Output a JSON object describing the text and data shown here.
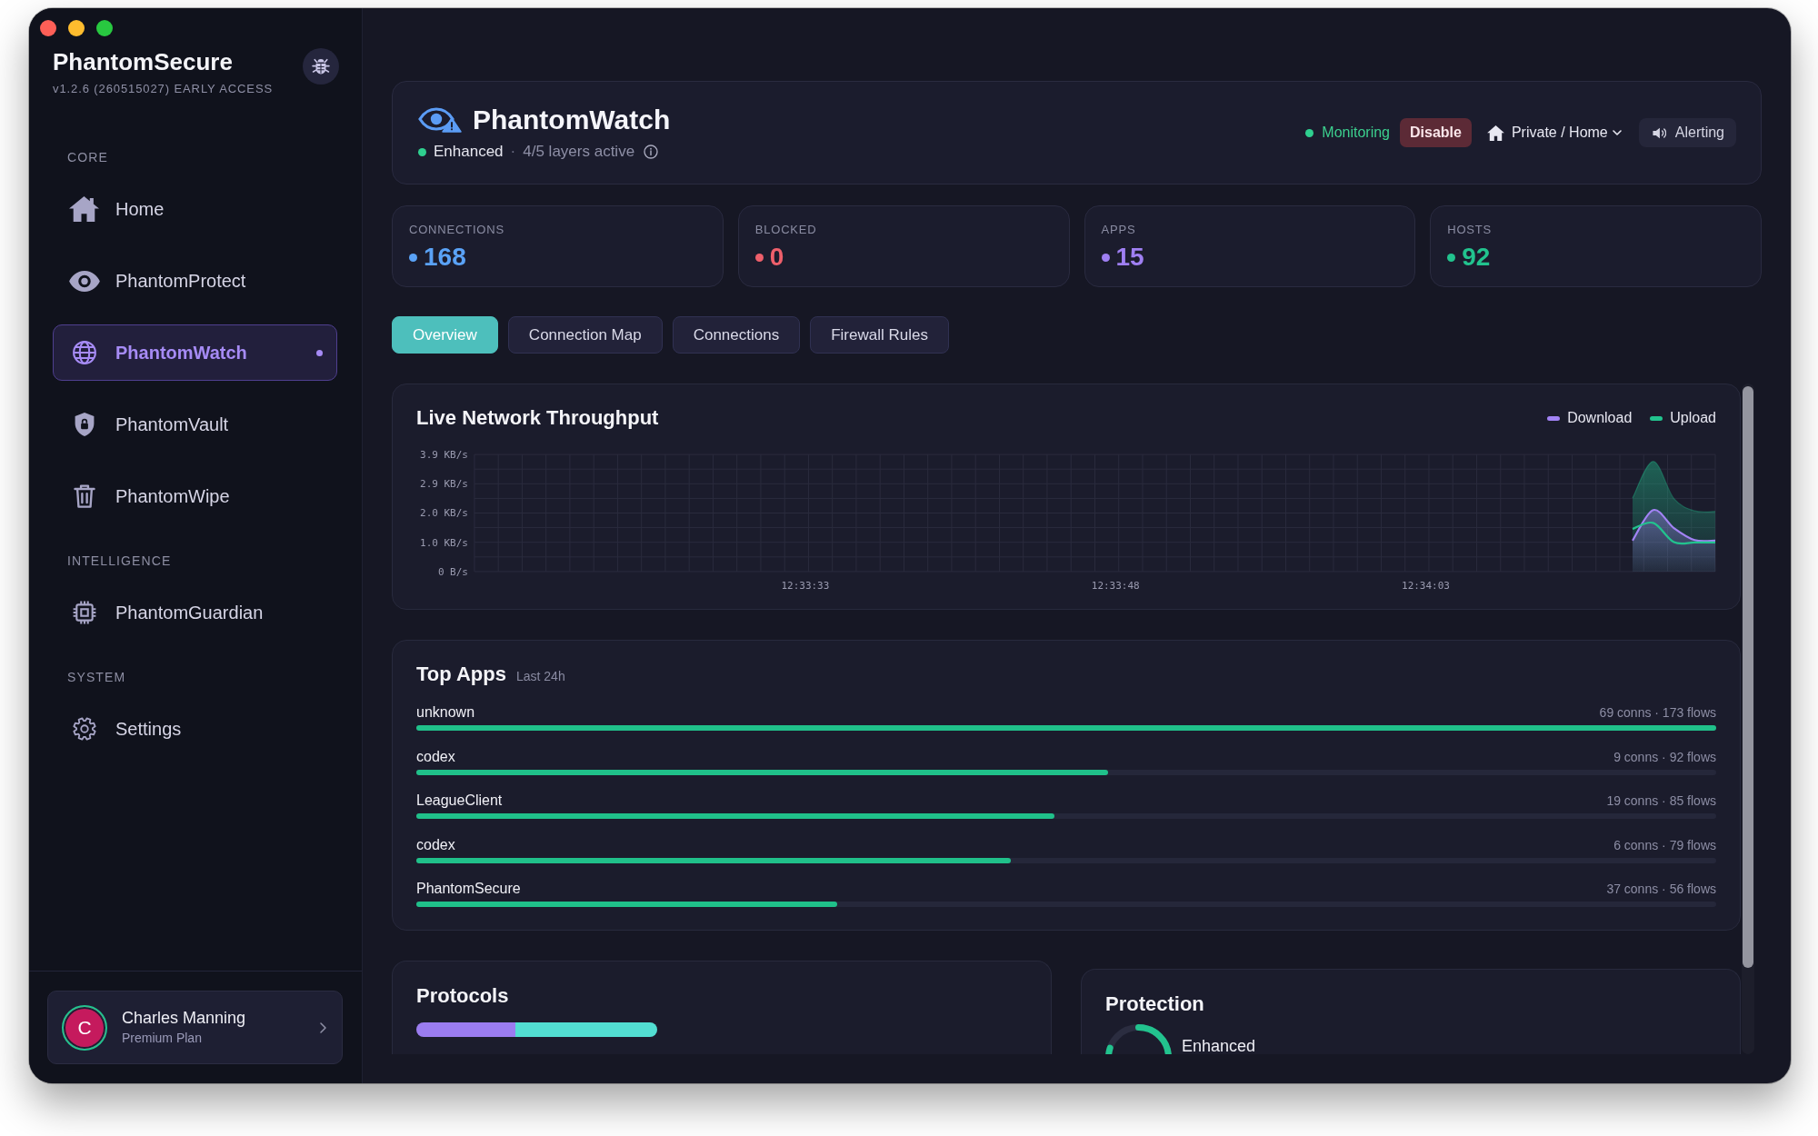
{
  "sidebar": {
    "app_name": "PhantomSecure",
    "version": "v1.2.6 (260515027) EARLY ACCESS",
    "sections": [
      {
        "label": "CORE",
        "items": [
          {
            "label": "Home",
            "selected": false
          },
          {
            "label": "PhantomProtect",
            "selected": false
          },
          {
            "label": "PhantomWatch",
            "selected": true
          },
          {
            "label": "PhantomVault",
            "selected": false
          },
          {
            "label": "PhantomWipe",
            "selected": false
          }
        ]
      },
      {
        "label": "INTELLIGENCE",
        "items": [
          {
            "label": "PhantomGuardian",
            "selected": false
          }
        ]
      },
      {
        "label": "SYSTEM",
        "items": [
          {
            "label": "Settings",
            "selected": false
          }
        ]
      }
    ],
    "user": {
      "initial": "C",
      "name": "Charles Manning",
      "plan": "Premium Plan"
    }
  },
  "header": {
    "title": "PhantomWatch",
    "status": "Enhanced",
    "separator": "·",
    "layers": "4/5 layers active",
    "monitoring": "Monitoring",
    "disable_button": "Disable",
    "network_profile": "Private / Home",
    "alerting_button": "Alerting"
  },
  "stats": [
    {
      "label": "CONNECTIONS",
      "value": "168",
      "color": "#5aa2f6"
    },
    {
      "label": "BLOCKED",
      "value": "0",
      "color": "#ee5f6b"
    },
    {
      "label": "APPS",
      "value": "15",
      "color": "#9f7ff2"
    },
    {
      "label": "HOSTS",
      "value": "92",
      "color": "#22c38e"
    }
  ],
  "tabs": [
    {
      "label": "Overview",
      "selected": true
    },
    {
      "label": "Connection Map",
      "selected": false
    },
    {
      "label": "Connections",
      "selected": false
    },
    {
      "label": "Firewall Rules",
      "selected": false
    }
  ],
  "throughput": {
    "chart_data": {
      "type": "area",
      "title": "Live Network Throughput",
      "categories": [
        null,
        null,
        null,
        null,
        null,
        null,
        null,
        null,
        null,
        null,
        null,
        null,
        null,
        null,
        null,
        null,
        "12:33:33",
        null,
        null,
        null,
        null,
        null,
        null,
        null,
        null,
        null,
        null,
        null,
        null,
        null,
        null,
        "12:33:48",
        null,
        null,
        null,
        null,
        null,
        null,
        null,
        null,
        null,
        null,
        null,
        null,
        null,
        null,
        "12:34:03",
        null,
        null,
        null,
        null,
        null,
        null,
        null,
        null,
        null,
        null,
        null,
        null,
        null,
        null
      ],
      "series": [
        {
          "name": "Download",
          "type": "area",
          "color": "#a283f5",
          "values": [
            null,
            null,
            null,
            null,
            null,
            null,
            null,
            null,
            null,
            null,
            null,
            null,
            null,
            null,
            null,
            null,
            null,
            null,
            null,
            null,
            null,
            null,
            null,
            null,
            null,
            null,
            null,
            null,
            null,
            null,
            null,
            null,
            null,
            null,
            null,
            null,
            null,
            null,
            null,
            null,
            null,
            null,
            null,
            null,
            null,
            null,
            null,
            null,
            null,
            null,
            null,
            null,
            null,
            null,
            null,
            null,
            1.03,
            2.05,
            1.45,
            1.05,
            1.03
          ]
        },
        {
          "name": "Upload",
          "type": "line",
          "color": "#22c38e",
          "values": [
            null,
            null,
            null,
            null,
            null,
            null,
            null,
            null,
            null,
            null,
            null,
            null,
            null,
            null,
            null,
            null,
            null,
            null,
            null,
            null,
            null,
            null,
            null,
            null,
            null,
            null,
            null,
            null,
            null,
            null,
            null,
            null,
            null,
            null,
            null,
            null,
            null,
            null,
            null,
            null,
            null,
            null,
            null,
            null,
            null,
            null,
            null,
            null,
            null,
            null,
            null,
            null,
            null,
            null,
            null,
            null,
            1.42,
            1.62,
            0.98,
            0.97,
            0.97
          ]
        },
        {
          "type": "area",
          "color": "#22c38e",
          "values": [
            null,
            null,
            null,
            null,
            null,
            null,
            null,
            null,
            null,
            null,
            null,
            null,
            null,
            null,
            null,
            null,
            null,
            null,
            null,
            null,
            null,
            null,
            null,
            null,
            null,
            null,
            null,
            null,
            null,
            null,
            null,
            null,
            null,
            null,
            null,
            null,
            null,
            null,
            null,
            null,
            null,
            null,
            null,
            null,
            null,
            null,
            null,
            null,
            null,
            null,
            null,
            null,
            null,
            null,
            null,
            null,
            2.45,
            3.67,
            2.43,
            2.02,
            2.0
          ]
        }
      ],
      "ylim": [
        0,
        3.9
      ],
      "yticks": [
        {
          "value": 0,
          "label": "0 B/s"
        },
        {
          "value": 0.975,
          "label": "1.0 KB/s"
        },
        {
          "value": 1.95,
          "label": "2.0 KB/s"
        },
        {
          "value": 2.925,
          "label": "2.9 KB/s"
        },
        {
          "value": 3.9,
          "label": "3.9 KB/s"
        }
      ],
      "grid": true
    }
  },
  "top_apps": {
    "title": "Top Apps",
    "period": "Last 24h",
    "rows": [
      {
        "name": "unknown",
        "stats": "69 conns · 173 flows",
        "level": 1.0
      },
      {
        "name": "codex",
        "stats": "9 conns · 92 flows",
        "level": 0.532
      },
      {
        "name": "LeagueClient",
        "stats": "19 conns · 85 flows",
        "level": 0.491
      },
      {
        "name": "codex",
        "stats": "6 conns · 79 flows",
        "level": 0.457
      },
      {
        "name": "PhantomSecure",
        "stats": "37 conns · 56 flows",
        "level": 0.324
      }
    ]
  },
  "protocols": {
    "title": "Protocols",
    "segments": [
      {
        "color": "#9b7cf0",
        "level": 0.41
      },
      {
        "color": "#52ded2",
        "level": 0.59
      }
    ]
  },
  "protection": {
    "title": "Protection",
    "status": "Enhanced"
  }
}
